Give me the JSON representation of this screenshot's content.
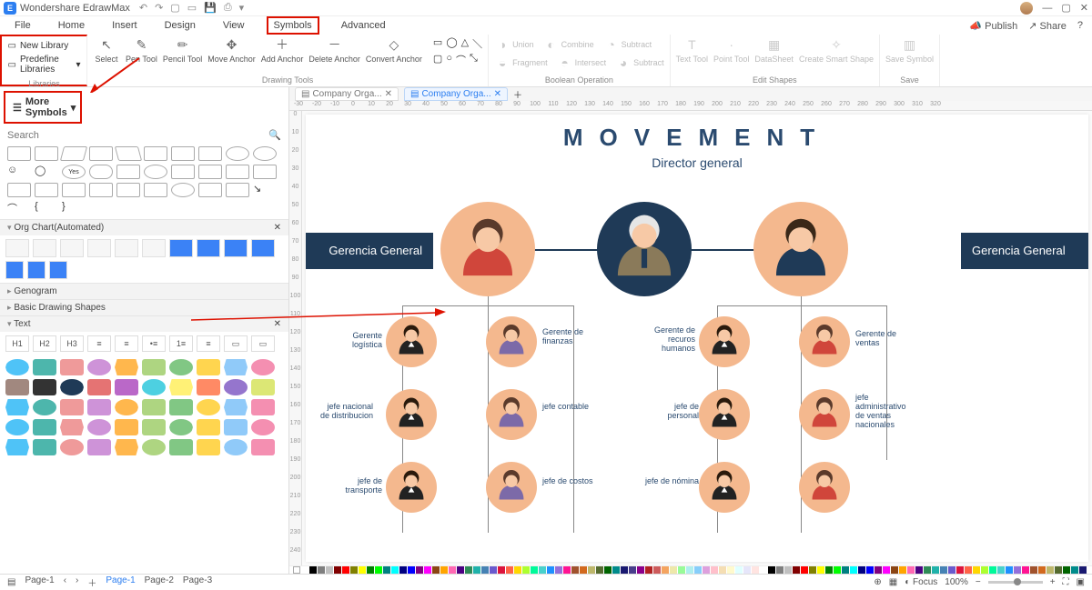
{
  "app": {
    "title": "Wondershare EdrawMax"
  },
  "menu": {
    "file": "File",
    "home": "Home",
    "insert": "Insert",
    "design": "Design",
    "view": "View",
    "symbols": "Symbols",
    "advanced": "Advanced",
    "publish": "Publish",
    "share": "Share"
  },
  "ribbon": {
    "libraries": {
      "new": "New Library",
      "predef": "Predefine Libraries",
      "label": "Libraries"
    },
    "select": "Select",
    "pen": "Pen Tool",
    "pencil": "Pencil Tool",
    "move": "Move Anchor",
    "add": "Add Anchor",
    "del": "Delete Anchor",
    "conv": "Convert Anchor",
    "drawing_label": "Drawing Tools",
    "union": "Union",
    "combine": "Combine",
    "subtract": "Subtract",
    "fragment": "Fragment",
    "intersect": "Intersect",
    "subtract2": "Subtract",
    "bool_label": "Boolean Operation",
    "text": "Text Tool",
    "point": "Point Tool",
    "datasheet": "DataSheet",
    "smart": "Create Smart Shape",
    "edit_label": "Edit Shapes",
    "save_sym": "Save Symbol",
    "save_label": "Save"
  },
  "sidebar": {
    "more": "More Symbols",
    "search_ph": "Search",
    "cat_org": "Org Chart(Automated)",
    "cat_gen": "Genogram",
    "cat_basic": "Basic Drawing Shapes",
    "cat_text": "Text",
    "h1": "H1",
    "h2": "H2",
    "h3": "H3"
  },
  "tabs": {
    "t1": "Company Orga...",
    "t2": "Company Orga..."
  },
  "chart": {
    "title": "MOVEMENT",
    "director": "Director general",
    "ger": "Gerencia General",
    "p": {
      "log": "Gerente logística",
      "fin": "Gerente de finanzas",
      "rh": "Gerente de recuros humanos",
      "ven": "Gerente de ventas",
      "dist": "jefe nacional de distribucion",
      "cont": "jefe contable",
      "pers": "jefe de personal",
      "adm": "jefe administrativo de ventas nacionales",
      "trans": "jefe de transporte",
      "cost": "jefe de costos",
      "nom": "jefe de nómina"
    }
  },
  "pages": {
    "p1": "Page-1",
    "p2": "Page-2",
    "p3": "Page-3"
  },
  "status": {
    "focus": "Focus",
    "zoom": "100%"
  }
}
